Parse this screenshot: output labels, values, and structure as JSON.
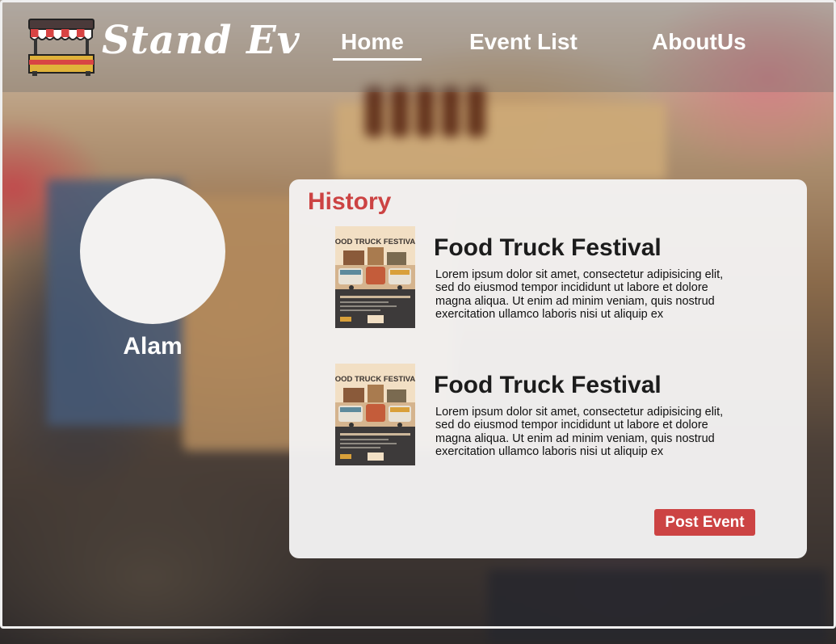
{
  "header": {
    "logo_text": "Stand Ev",
    "nav": [
      {
        "label": "Home",
        "active": true
      },
      {
        "label": "Event List",
        "active": false
      },
      {
        "label": "AboutUs",
        "active": false
      }
    ]
  },
  "profile": {
    "name": "Alam"
  },
  "history": {
    "title": "History",
    "events": [
      {
        "title": "Food Truck Festival",
        "description": "Lorem ipsum dolor sit amet, consectetur adipisicing elit, sed do eiusmod tempor incididunt ut labore et dolore magna aliqua. Ut enim ad minim veniam, quis nostrud exercitation ullamco laboris nisi ut aliquip ex",
        "poster_title": "FOOD TRUCK FESTIVAL"
      },
      {
        "title": "Food Truck Festival",
        "description": "Lorem ipsum dolor sit amet, consectetur adipisicing elit, sed do eiusmod tempor incididunt ut labore et dolore magna aliqua. Ut enim ad minim veniam, quis nostrud exercitation ullamco laboris nisi ut aliquip ex",
        "poster_title": "FOOD TRUCK FESTIVAL"
      }
    ],
    "post_button_label": "Post Event"
  },
  "colors": {
    "accent": "#cc4343",
    "panel_bg": "#f4f3f2",
    "text_dark": "#1c1c1c",
    "nav_text": "#ffffff"
  },
  "icons": {
    "logo": "market-stall-icon"
  }
}
